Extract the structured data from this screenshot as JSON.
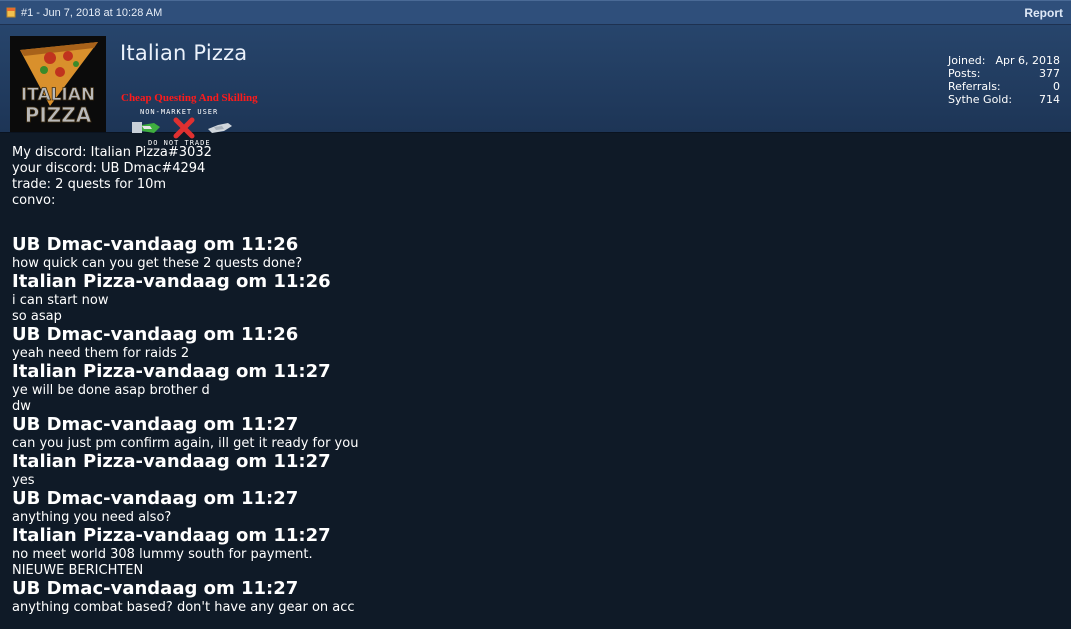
{
  "post": {
    "meta": "#1 - Jun 7, 2018 at 10:28 AM",
    "report_label": "Report"
  },
  "user": {
    "name": "Italian Pizza",
    "title": "Cheap Questing And Skilling",
    "badge_top": "NON-MARKET USER",
    "badge_bottom": "DO NOT TRADE",
    "avatar_text_1": "ITALIAN",
    "avatar_text_2": "PIZZA"
  },
  "stats": [
    {
      "label": "Joined:",
      "value": "Apr 6, 2018"
    },
    {
      "label": "Posts:",
      "value": "377"
    },
    {
      "label": "Referrals:",
      "value": "0"
    },
    {
      "label": "Sythe Gold:",
      "value": "714"
    }
  ],
  "body": {
    "intro": [
      "My discord: Italian Pizza#3032",
      "your discord: UB Dmac#4294",
      "trade: 2 quests for 10m",
      "convo:"
    ],
    "convo": [
      {
        "header": "UB Dmac-vandaag om 11:26",
        "lines": [
          "how quick can you get these 2 quests done?"
        ]
      },
      {
        "header": "Italian Pizza-vandaag om 11:26",
        "lines": [
          "i can start now",
          "so asap"
        ]
      },
      {
        "header": "UB Dmac-vandaag om 11:26",
        "lines": [
          "yeah need them for raids 2"
        ]
      },
      {
        "header": "Italian Pizza-vandaag om 11:27",
        "lines": [
          "ye will be done asap brother d",
          "dw"
        ]
      },
      {
        "header": "UB Dmac-vandaag om 11:27",
        "lines": [
          "can you just pm confirm again, ill get it ready for you"
        ]
      },
      {
        "header": "Italian Pizza-vandaag om 11:27",
        "lines": [
          "yes"
        ]
      },
      {
        "header": "UB Dmac-vandaag om 11:27",
        "lines": [
          "anything you need also?"
        ]
      },
      {
        "header": "Italian Pizza-vandaag om 11:27",
        "lines": [
          "no meet world 308 lummy south for payment.",
          "NIEUWE BERICHTEN"
        ]
      },
      {
        "header": "UB Dmac-vandaag om 11:27",
        "lines": [
          "anything combat based? don't have any gear on acc"
        ]
      }
    ]
  },
  "colors": {
    "topbar": "#2f4f7b",
    "userbar": "#27456c",
    "content_bg": "#0f1a27",
    "title_red": "#ff1a1a"
  }
}
